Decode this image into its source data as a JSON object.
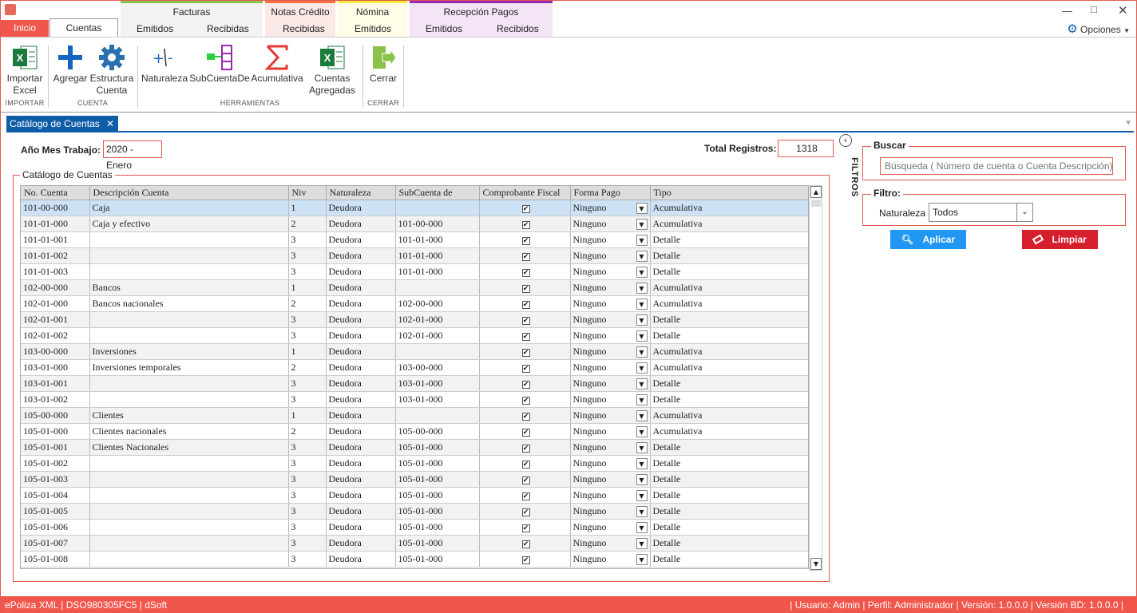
{
  "menu": {
    "inicio": "Inicio",
    "cuentas": "Cuentas",
    "groups": [
      {
        "title": "Facturas",
        "color": "#8bc34a",
        "sub": [
          "Emitidos",
          "Recibidas"
        ]
      },
      {
        "title": "Notas Crédito",
        "color": "#ff7043",
        "sub": [
          "Recibidas"
        ]
      },
      {
        "title": "Nómina",
        "color": "#ffeb3b",
        "sub": [
          "Emitidos"
        ]
      },
      {
        "title": "Recepción Pagos",
        "color": "#9c27b0",
        "sub": [
          "Emitidos",
          "Recibidos"
        ]
      }
    ],
    "opciones": "Opciones"
  },
  "ribbon": {
    "importar_excel": "Importar\nExcel",
    "agregar": "Agregar",
    "estructura": "Estructura\nCuenta",
    "naturaleza": "Naturaleza",
    "subcuentade": "SubCuentaDe",
    "acumulativa": "Acumulativa",
    "cuentas_agregadas": "Cuentas\nAgregadas",
    "cerrar": "Cerrar",
    "grp_importar": "IMPORTAR",
    "grp_cuenta": "CUENTA",
    "grp_herramientas": "HERRAMIENTAS",
    "grp_cerrar": "CERRAR"
  },
  "doc_tab": "Catálogo de Cuentas",
  "form": {
    "anio_label": "Año Mes Trabajo:",
    "anio_value": "2020 - Enero",
    "total_label": "Total Registros:",
    "total_value": "1318",
    "catalogo_legend": "Catálogo de Cuentas"
  },
  "grid": {
    "columns": [
      "No. Cuenta",
      "Descripción Cuenta",
      "Niv",
      "Naturaleza",
      "SubCuenta de",
      "Comprobante Fiscal",
      "Forma Pago",
      "Tipo"
    ],
    "rows": [
      [
        "101-00-000",
        "Caja",
        "1",
        "Deudora",
        "",
        "✔",
        "Ninguno",
        "Acumulativa"
      ],
      [
        "101-01-000",
        "Caja y efectivo",
        "2",
        "Deudora",
        "101-00-000",
        "✔",
        "Ninguno",
        "Acumulativa"
      ],
      [
        "101-01-001",
        "",
        "3",
        "Deudora",
        "101-01-000",
        "✔",
        "Ninguno",
        "Detalle"
      ],
      [
        "101-01-002",
        "",
        "3",
        "Deudora",
        "101-01-000",
        "✔",
        "Ninguno",
        "Detalle"
      ],
      [
        "101-01-003",
        "",
        "3",
        "Deudora",
        "101-01-000",
        "✔",
        "Ninguno",
        "Detalle"
      ],
      [
        "102-00-000",
        "Bancos",
        "1",
        "Deudora",
        "",
        "✔",
        "Ninguno",
        "Acumulativa"
      ],
      [
        "102-01-000",
        "Bancos nacionales",
        "2",
        "Deudora",
        "102-00-000",
        "✔",
        "Ninguno",
        "Acumulativa"
      ],
      [
        "102-01-001",
        "",
        "3",
        "Deudora",
        "102-01-000",
        "✔",
        "Ninguno",
        "Detalle"
      ],
      [
        "102-01-002",
        "",
        "3",
        "Deudora",
        "102-01-000",
        "✔",
        "Ninguno",
        "Detalle"
      ],
      [
        "103-00-000",
        "Inversiones",
        "1",
        "Deudora",
        "",
        "✔",
        "Ninguno",
        "Acumulativa"
      ],
      [
        "103-01-000",
        "Inversiones temporales",
        "2",
        "Deudora",
        "103-00-000",
        "✔",
        "Ninguno",
        "Acumulativa"
      ],
      [
        "103-01-001",
        "",
        "3",
        "Deudora",
        "103-01-000",
        "✔",
        "Ninguno",
        "Detalle"
      ],
      [
        "103-01-002",
        "",
        "3",
        "Deudora",
        "103-01-000",
        "✔",
        "Ninguno",
        "Detalle"
      ],
      [
        "105-00-000",
        "Clientes",
        "1",
        "Deudora",
        "",
        "✔",
        "Ninguno",
        "Acumulativa"
      ],
      [
        "105-01-000",
        "Clientes nacionales",
        "2",
        "Deudora",
        "105-00-000",
        "✔",
        "Ninguno",
        "Acumulativa"
      ],
      [
        "105-01-001",
        "Clientes Nacionales",
        "3",
        "Deudora",
        "105-01-000",
        "✔",
        "Ninguno",
        "Detalle"
      ],
      [
        "105-01-002",
        "",
        "3",
        "Deudora",
        "105-01-000",
        "✔",
        "Ninguno",
        "Detalle"
      ],
      [
        "105-01-003",
        "",
        "3",
        "Deudora",
        "105-01-000",
        "✔",
        "Ninguno",
        "Detalle"
      ],
      [
        "105-01-004",
        "",
        "3",
        "Deudora",
        "105-01-000",
        "✔",
        "Ninguno",
        "Detalle"
      ],
      [
        "105-01-005",
        "",
        "3",
        "Deudora",
        "105-01-000",
        "✔",
        "Ninguno",
        "Detalle"
      ],
      [
        "105-01-006",
        "",
        "3",
        "Deudora",
        "105-01-000",
        "✔",
        "Ninguno",
        "Detalle"
      ],
      [
        "105-01-007",
        "",
        "3",
        "Deudora",
        "105-01-000",
        "✔",
        "Ninguno",
        "Detalle"
      ],
      [
        "105-01-008",
        "",
        "3",
        "Deudora",
        "105-01-000",
        "✔",
        "Ninguno",
        "Detalle"
      ]
    ]
  },
  "filters": {
    "filtros_label": "FILTROS",
    "buscar_legend": "Buscar",
    "buscar_placeholder": "Búsqueda ( Número de cuenta o Cuenta Descripción)",
    "filtro_legend": "Filtro:",
    "naturaleza_label": "Naturaleza",
    "naturaleza_value": "Todos",
    "aplicar": "Aplicar",
    "limpiar": "Limpiar"
  },
  "status": {
    "left": "ePoliza XML | DSO980305FC5 | dSoft",
    "right": "| Usuario: Admin | Perfil: Administrador | Versión: 1.0.0.0 | Versión BD: 1.0.0.0 |"
  }
}
